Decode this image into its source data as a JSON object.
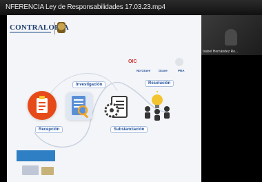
{
  "window": {
    "title": "NFERENCIA Ley de Responsabilidades 17.03.23.mp4"
  },
  "slide": {
    "logo_text": "CONTRALORÍA",
    "oic": "OIC",
    "oic_tags": [
      "No Grave",
      "Grave",
      "PRA"
    ],
    "steps": {
      "recepcion": "Recepción",
      "investigacion": "Investigación",
      "substanciacion": "Substanciación",
      "resolucion": "Resolución"
    }
  },
  "webcam": {
    "participant_name": "Isabel Hernández Ro..."
  },
  "colors": {
    "accent_red": "#d32f2f",
    "accent_blue": "#1f4e99",
    "icon_orange": "#e64a19"
  }
}
